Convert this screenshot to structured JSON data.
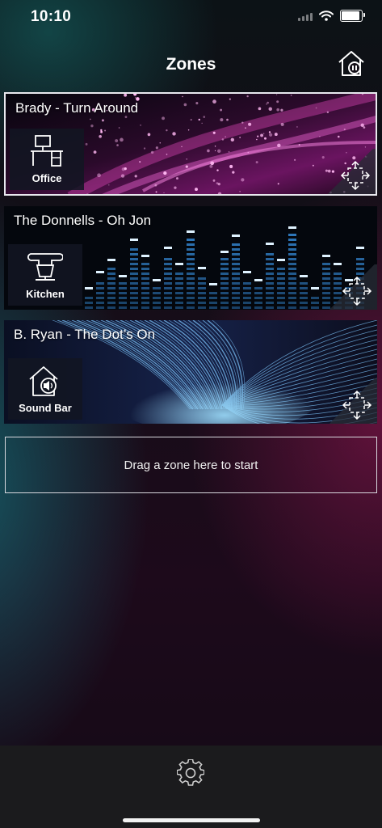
{
  "status_bar": {
    "time": "10:10",
    "battery_level": 0.9
  },
  "header": {
    "title": "Zones",
    "home_button_icon": "home-pause-icon"
  },
  "zones": [
    {
      "title": "Brady - Turn Around",
      "room": "Office",
      "room_icon": "desk-computer-icon",
      "background": "pink-particles",
      "selected": true
    },
    {
      "title": "The Donnells - Oh Jon",
      "room": "Kitchen",
      "room_icon": "stand-mixer-icon",
      "background": "blue-equalizer",
      "selected": false
    },
    {
      "title": "B. Ryan - The Dot’s On",
      "room": "Sound Bar",
      "room_icon": "home-speaker-icon",
      "background": "fiber-optic",
      "selected": false
    }
  ],
  "drop_zone": {
    "label": "Drag a zone here to start"
  },
  "tab_bar": {
    "settings_icon": "gear-icon"
  },
  "colors": {
    "selected_border": "#e8e8ee",
    "tile_bg": "#121622",
    "tab_bar_bg": "#1b1b1d",
    "accent_pink": "#ff3fc4",
    "accent_blue": "#4fb8ff"
  }
}
